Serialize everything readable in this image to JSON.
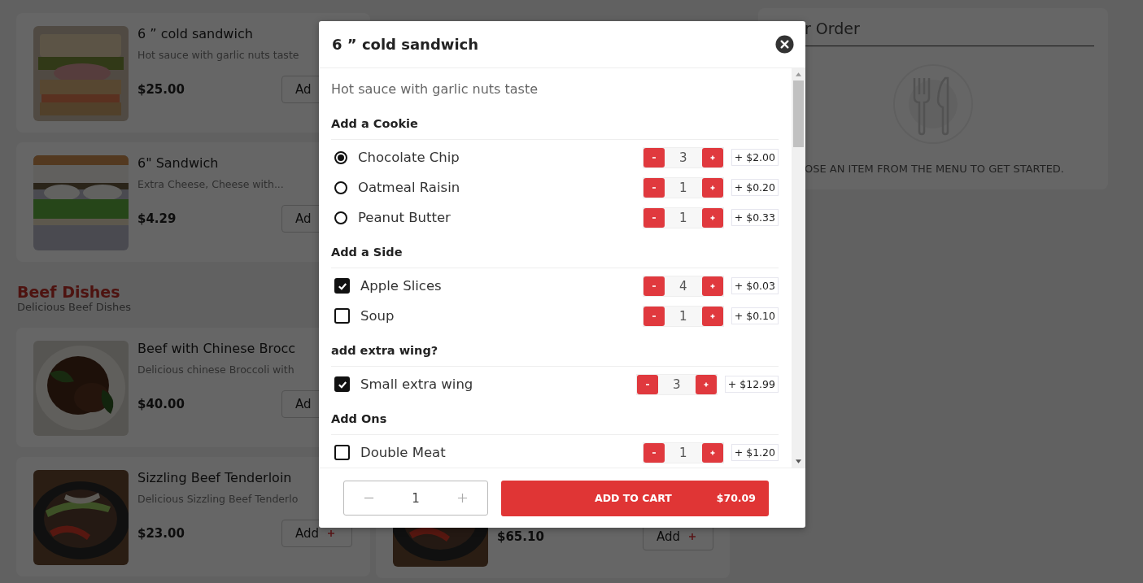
{
  "menu": [
    {
      "kind": "dish",
      "name": "6 ” cold sandwich",
      "description": "Hot sauce with garlic nuts taste",
      "price": "$25.00",
      "button": "Ad"
    },
    {
      "kind": "dish",
      "name": "6\" Sandwich",
      "description": "Extra Cheese, Cheese with...",
      "price": "$4.29",
      "button": "Ad"
    },
    {
      "kind": "section",
      "title": "Beef Dishes",
      "subtitle": "Delicious Beef Dishes"
    },
    {
      "kind": "dish",
      "name": "Beef with Chinese Brocc",
      "description": "Delicious chinese Broccoli with",
      "price": "$40.00",
      "button": "Ad"
    },
    {
      "kind": "dish",
      "name": "Sizzling Beef Tenderloin",
      "description": "Delicious Sizzling Beef  Tenderlo",
      "price": "$23.00",
      "button": "Add"
    }
  ],
  "middle_card": {
    "price": "$65.10",
    "button": "Add"
  },
  "order_panel": {
    "title": "r Order",
    "message": "OSE AN ITEM FROM THE MENU TO GET STARTED."
  },
  "modal": {
    "title": "6 ” cold sandwich",
    "description": "Hot sauce with garlic nuts taste",
    "groups": [
      {
        "title": "Add a Cookie",
        "options": [
          {
            "kind": "radio",
            "label": "Chocolate Chip",
            "selected": true,
            "quantity": "3",
            "price": "+ $2.00"
          },
          {
            "kind": "radio",
            "label": "Oatmeal Raisin",
            "selected": false,
            "quantity": "1",
            "price": "+ $0.20"
          },
          {
            "kind": "radio",
            "label": "Peanut Butter",
            "selected": false,
            "quantity": "1",
            "price": "+ $0.33"
          }
        ]
      },
      {
        "title": "Add a Side",
        "options": [
          {
            "kind": "checkbox",
            "label": "Apple Slices",
            "checked": true,
            "quantity": "4",
            "price": "+ $0.03"
          },
          {
            "kind": "checkbox",
            "label": "Soup",
            "checked": false,
            "quantity": "1",
            "price": "+ $0.10"
          }
        ]
      },
      {
        "title": "add extra wing?",
        "options": [
          {
            "kind": "checkbox",
            "label": "Small extra wing",
            "checked": true,
            "quantity": "3",
            "price": "+ $12.99"
          }
        ]
      },
      {
        "title": "Add Ons",
        "options": [
          {
            "kind": "checkbox",
            "label": "Double Meat",
            "checked": false,
            "quantity": "1",
            "price": "+ $1.20"
          }
        ]
      }
    ],
    "quantity": "1",
    "add_to_cart": {
      "label": "ADD TO CART",
      "total": "$70.09"
    }
  }
}
